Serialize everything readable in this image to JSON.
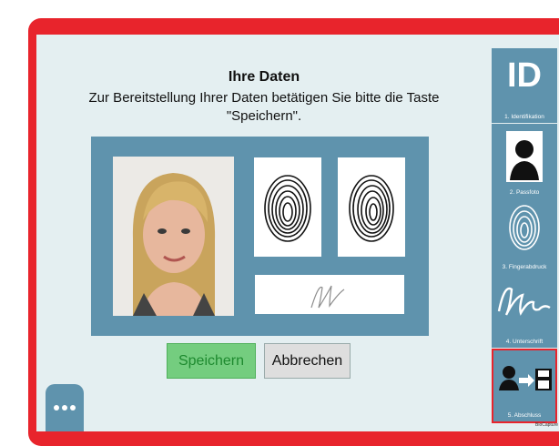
{
  "header": {
    "title": "Ihre Daten",
    "instruction": "Zur Bereitstellung Ihrer Daten betätigen Sie bitte die Taste \"Speichern\"."
  },
  "buttons": {
    "save": "Speichern",
    "cancel": "Abbrechen"
  },
  "steps": [
    {
      "label": "1. Identifikation",
      "icon": "id-icon",
      "badge": "ID"
    },
    {
      "label": "2. Passfoto",
      "icon": "portrait-icon"
    },
    {
      "label": "3. Fingerabdruck",
      "icon": "fingerprint-icon"
    },
    {
      "label": "4. Unterschrift",
      "icon": "signature-icon"
    },
    {
      "label": "5. Abschluss",
      "icon": "save-transfer-icon"
    }
  ],
  "brand": "BioCapture",
  "colors": {
    "frame": "#e8242c",
    "panel": "#e4eff1",
    "accent": "#5f93ad",
    "save_button": "#74cd7f"
  }
}
